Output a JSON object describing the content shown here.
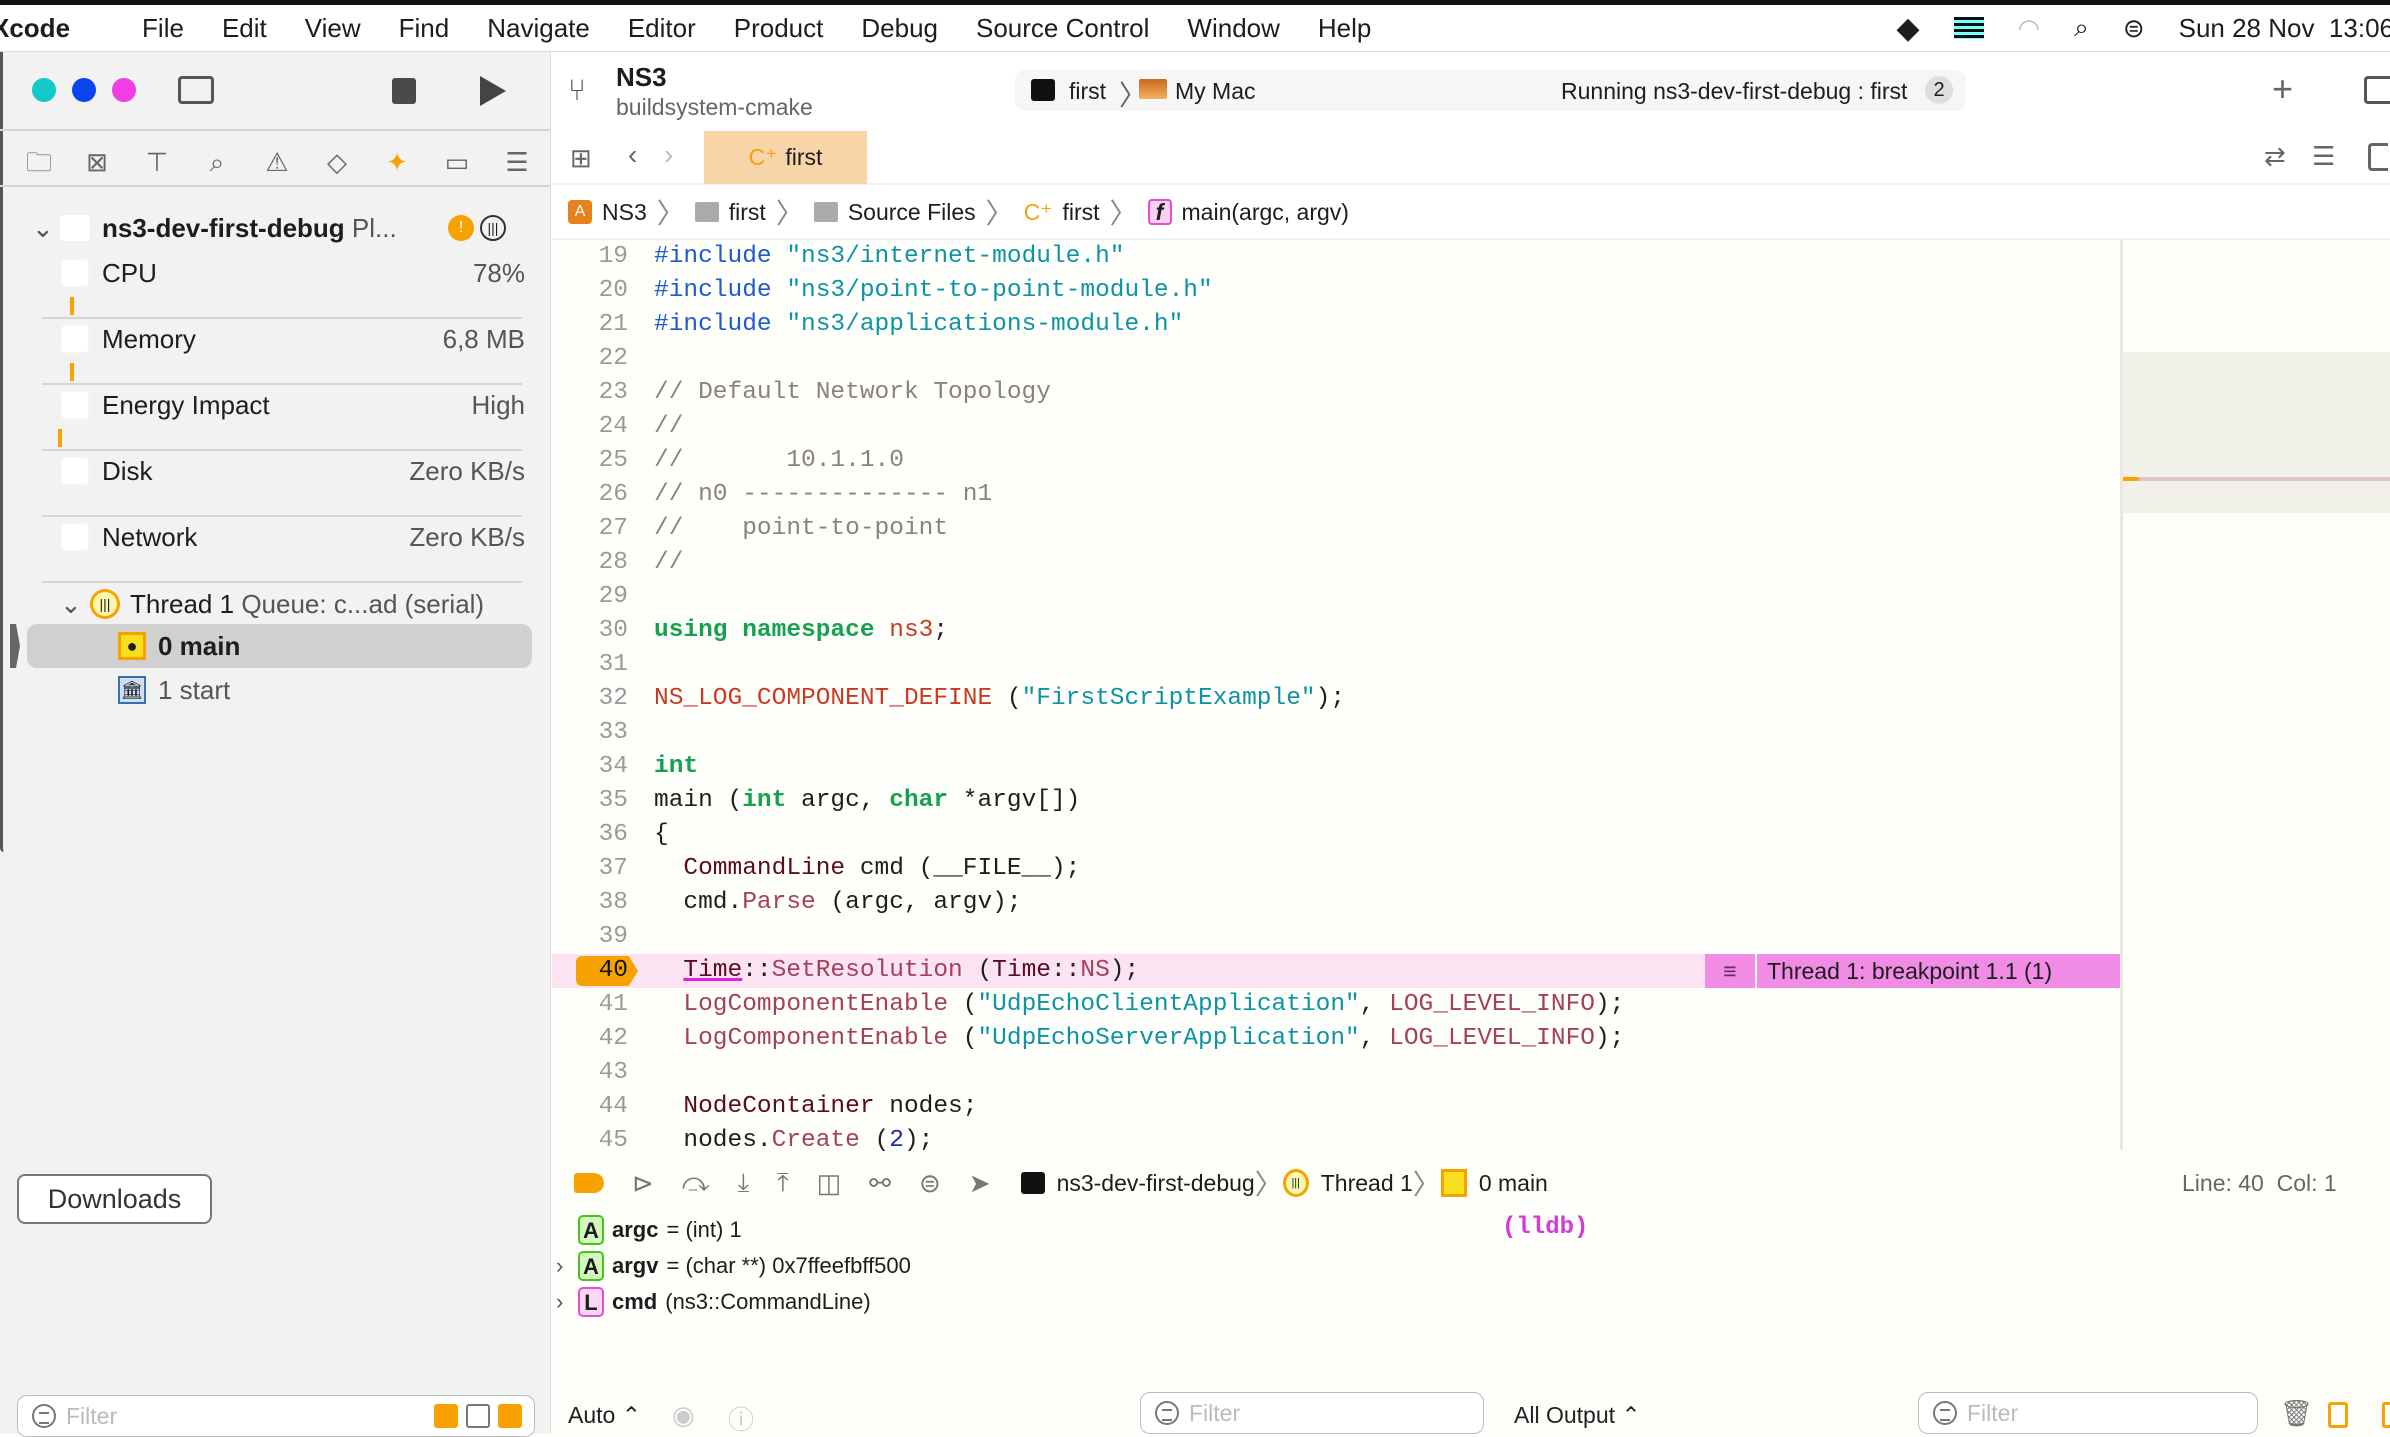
{
  "menubar": {
    "app": "Xcode",
    "items": [
      "File",
      "Edit",
      "View",
      "Find",
      "Navigate",
      "Editor",
      "Product",
      "Debug",
      "Source Control",
      "Window",
      "Help"
    ],
    "clock": "Sun 28 Nov  13:06"
  },
  "toolbar": {
    "project": "NS3",
    "branch": "buildsystem-cmake",
    "scheme": "first",
    "destination": "My Mac",
    "status": "Running ns3-dev-first-debug : first",
    "status_count": "2"
  },
  "tab": {
    "label": "first"
  },
  "jumpbar": [
    "NS3",
    "first",
    "Source Files",
    "first",
    "main(argc, argv)"
  ],
  "debug_nav": {
    "process": "ns3-dev-first-debug",
    "process_suffix": "Pl...",
    "gauges": [
      {
        "label": "CPU",
        "value": "78%"
      },
      {
        "label": "Memory",
        "value": "6,8 MB"
      },
      {
        "label": "Energy Impact",
        "value": "High"
      },
      {
        "label": "Disk",
        "value": "Zero KB/s"
      },
      {
        "label": "Network",
        "value": "Zero KB/s"
      }
    ],
    "thread": "Thread 1",
    "queue": "Queue: c...ad (serial)",
    "frames": [
      "0 main",
      "1 start"
    ],
    "downloads": "Downloads",
    "filter_placeholder": "Filter"
  },
  "code": {
    "current_line": 40,
    "breakpoint_label": "Thread 1: breakpoint 1.1 (1)",
    "lines": [
      {
        "n": "19",
        "t": [
          [
            "pp",
            "#include "
          ],
          [
            "str",
            "\"ns3/internet-module.h\""
          ]
        ]
      },
      {
        "n": "20",
        "t": [
          [
            "pp",
            "#include "
          ],
          [
            "str",
            "\"ns3/point-to-point-module.h\""
          ]
        ]
      },
      {
        "n": "21",
        "t": [
          [
            "pp",
            "#include "
          ],
          [
            "str",
            "\"ns3/applications-module.h\""
          ]
        ]
      },
      {
        "n": "22",
        "t": []
      },
      {
        "n": "23",
        "t": [
          [
            "cm",
            "// Default Network Topology"
          ]
        ]
      },
      {
        "n": "24",
        "t": [
          [
            "cm",
            "//"
          ]
        ]
      },
      {
        "n": "25",
        "t": [
          [
            "cm",
            "//       10.1.1.0"
          ]
        ]
      },
      {
        "n": "26",
        "t": [
          [
            "cm",
            "// n0 -------------- n1"
          ]
        ]
      },
      {
        "n": "27",
        "t": [
          [
            "cm",
            "//    point-to-point"
          ]
        ]
      },
      {
        "n": "28",
        "t": [
          [
            "cm",
            "//"
          ]
        ]
      },
      {
        "n": "29",
        "t": []
      },
      {
        "n": "30",
        "t": [
          [
            "kw",
            "using "
          ],
          [
            "kw",
            "namespace "
          ],
          [
            "mac",
            "ns3"
          ],
          [
            "pl",
            ";"
          ]
        ]
      },
      {
        "n": "31",
        "t": []
      },
      {
        "n": "32",
        "t": [
          [
            "mac",
            "NS_LOG_COMPONENT_DEFINE"
          ],
          [
            "pl",
            " ("
          ],
          [
            "str",
            "\"FirstScriptExample\""
          ],
          [
            "pl",
            ");"
          ]
        ]
      },
      {
        "n": "33",
        "t": []
      },
      {
        "n": "34",
        "t": [
          [
            "kw",
            "int"
          ]
        ]
      },
      {
        "n": "35",
        "t": [
          [
            "pl",
            "main ("
          ],
          [
            "kw",
            "int"
          ],
          [
            "pl",
            " argc, "
          ],
          [
            "kw",
            "char"
          ],
          [
            "pl",
            " *argv[])"
          ]
        ]
      },
      {
        "n": "36",
        "t": [
          [
            "pl",
            "{"
          ]
        ]
      },
      {
        "n": "37",
        "t": [
          [
            "pl",
            "  "
          ],
          [
            "ty",
            "CommandLine"
          ],
          [
            "pl",
            " cmd (__FILE__);"
          ]
        ]
      },
      {
        "n": "38",
        "t": [
          [
            "pl",
            "  cmd."
          ],
          [
            "fn",
            "Parse"
          ],
          [
            "pl",
            " (argc, argv);"
          ]
        ]
      },
      {
        "n": "39",
        "t": []
      },
      {
        "n": "40",
        "t": [
          [
            "pl",
            "  "
          ],
          [
            "ty",
            "Time"
          ],
          [
            "pl",
            "::"
          ],
          [
            "fn",
            "SetResolution"
          ],
          [
            "pl",
            " ("
          ],
          [
            "ty",
            "Time"
          ],
          [
            "pl",
            "::"
          ],
          [
            "fn",
            "NS"
          ],
          [
            "pl",
            ");"
          ]
        ]
      },
      {
        "n": "41",
        "t": [
          [
            "pl",
            "  "
          ],
          [
            "fn",
            "LogComponentEnable"
          ],
          [
            "pl",
            " ("
          ],
          [
            "str",
            "\"UdpEchoClientApplication\""
          ],
          [
            "pl",
            ", "
          ],
          [
            "fn",
            "LOG_LEVEL_INFO"
          ],
          [
            "pl",
            ");"
          ]
        ]
      },
      {
        "n": "42",
        "t": [
          [
            "pl",
            "  "
          ],
          [
            "fn",
            "LogComponentEnable"
          ],
          [
            "pl",
            " ("
          ],
          [
            "str",
            "\"UdpEchoServerApplication\""
          ],
          [
            "pl",
            ", "
          ],
          [
            "fn",
            "LOG_LEVEL_INFO"
          ],
          [
            "pl",
            ");"
          ]
        ]
      },
      {
        "n": "43",
        "t": []
      },
      {
        "n": "44",
        "t": [
          [
            "pl",
            "  "
          ],
          [
            "ty",
            "NodeContainer"
          ],
          [
            "pl",
            " nodes;"
          ]
        ]
      },
      {
        "n": "45",
        "t": [
          [
            "pl",
            "  nodes."
          ],
          [
            "fn",
            "Create"
          ],
          [
            "pl",
            " ("
          ],
          [
            "num",
            "2"
          ],
          [
            "pl",
            ");"
          ]
        ]
      }
    ]
  },
  "debugbar": {
    "process": "ns3-dev-first-debug",
    "thread": "Thread 1",
    "frame": "0 main",
    "position": "Line: 40  Col: 1"
  },
  "variables": [
    {
      "badge": "A",
      "name": "argc",
      "detail": "= (int) 1",
      "expandable": false
    },
    {
      "badge": "A",
      "name": "argv",
      "detail": "= (char **) 0x7ffeefbff500",
      "expandable": true
    },
    {
      "badge": "L",
      "name": "cmd",
      "detail": "(ns3::CommandLine)",
      "expandable": true
    }
  ],
  "console": {
    "prompt": "(lldb)"
  },
  "bottombar": {
    "auto": "Auto ⌃",
    "filter_placeholder": "Filter",
    "output": "All Output ⌃",
    "console_filter_placeholder": "Filter"
  },
  "colors": {
    "accent": "#f7a200",
    "breakpoint_line": "#fbe3f1",
    "breakpoint_badge": "#f08be6",
    "tab_bg": "#f8d5a8",
    "sidebar_bg": "#f2f2f2"
  }
}
